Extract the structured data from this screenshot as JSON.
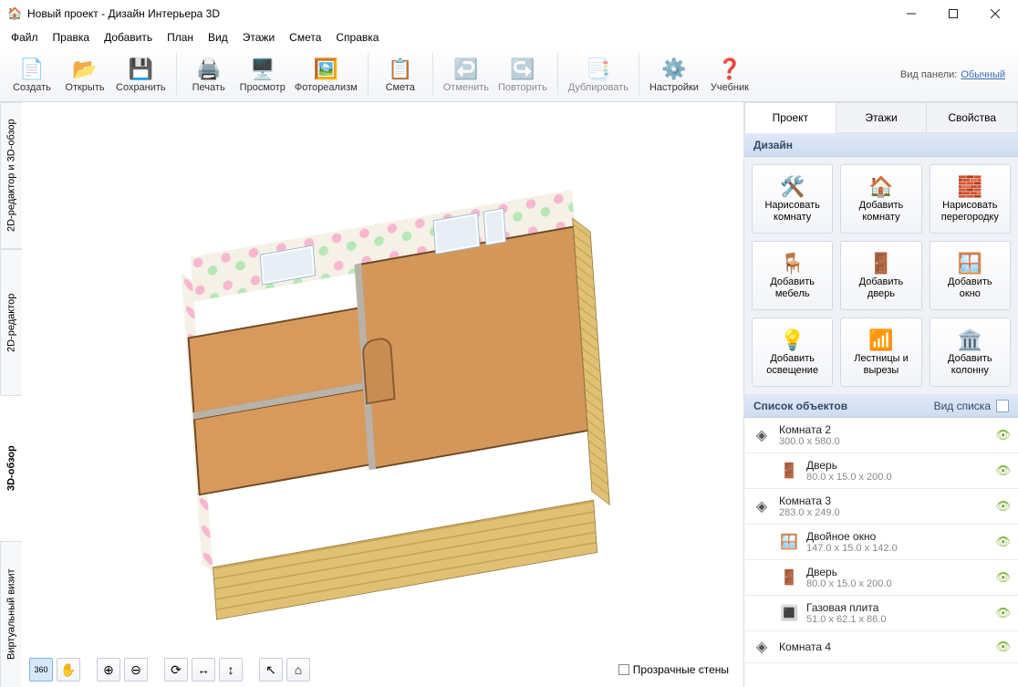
{
  "window": {
    "title": "Новый проект - Дизайн Интерьера 3D"
  },
  "menu": [
    "Файл",
    "Правка",
    "Добавить",
    "План",
    "Вид",
    "Этажи",
    "Смета",
    "Справка"
  ],
  "toolbar": {
    "groups": [
      [
        {
          "key": "create",
          "label": "Создать",
          "icon": "📄"
        },
        {
          "key": "open",
          "label": "Открыть",
          "icon": "📂"
        },
        {
          "key": "save",
          "label": "Сохранить",
          "icon": "💾"
        }
      ],
      [
        {
          "key": "print",
          "label": "Печать",
          "icon": "🖨️"
        },
        {
          "key": "preview",
          "label": "Просмотр",
          "icon": "🖥️"
        },
        {
          "key": "realism",
          "label": "Фотореализм",
          "icon": "🖼️"
        }
      ],
      [
        {
          "key": "estimate",
          "label": "Смета",
          "icon": "📋"
        }
      ],
      [
        {
          "key": "undo",
          "label": "Отменить",
          "icon": "↩️",
          "disabled": true
        },
        {
          "key": "redo",
          "label": "Повторить",
          "icon": "↪️",
          "disabled": true
        }
      ],
      [
        {
          "key": "duplicate",
          "label": "Дублировать",
          "icon": "📑",
          "disabled": true
        }
      ],
      [
        {
          "key": "settings",
          "label": "Настройки",
          "icon": "⚙️"
        },
        {
          "key": "tutorial",
          "label": "Учебник",
          "icon": "❓"
        }
      ]
    ],
    "panelLabel": "Вид панели:",
    "panelMode": "Обычный"
  },
  "leftTabs": [
    {
      "key": "2d-3d-review",
      "label": "2D-редактор и 3D-обзор"
    },
    {
      "key": "2d-editor",
      "label": "2D-редактор"
    },
    {
      "key": "3d-review",
      "label": "3D-обзор",
      "active": true
    },
    {
      "key": "virtual-visit",
      "label": "Виртуальный визит"
    }
  ],
  "viewportTools": [
    {
      "key": "orbit-360",
      "glyph": "360",
      "active": true,
      "small": true
    },
    {
      "key": "pan",
      "glyph": "✋"
    },
    {
      "key": "zoom-in",
      "glyph": "⊕"
    },
    {
      "key": "zoom-out",
      "glyph": "⊖"
    },
    {
      "key": "rotate",
      "glyph": "⟳"
    },
    {
      "key": "flip-h",
      "glyph": "↔"
    },
    {
      "key": "flip-v",
      "glyph": "↕"
    },
    {
      "key": "select",
      "glyph": "↖"
    },
    {
      "key": "home",
      "glyph": "⌂"
    }
  ],
  "transparentWalls": {
    "label": "Прозрачные стены",
    "checked": false
  },
  "rightTabs": [
    {
      "key": "project",
      "label": "Проект",
      "active": true
    },
    {
      "key": "floors",
      "label": "Этажи"
    },
    {
      "key": "properties",
      "label": "Свойства"
    }
  ],
  "designHeader": "Дизайн",
  "designButtons": [
    {
      "key": "draw-room",
      "icon": "🛠️",
      "label": "Нарисовать\nкомнату"
    },
    {
      "key": "add-room",
      "icon": "🏠",
      "label": "Добавить\nкомнату"
    },
    {
      "key": "draw-wall",
      "icon": "🧱",
      "label": "Нарисовать\nперегородку"
    },
    {
      "key": "add-furniture",
      "icon": "🪑",
      "label": "Добавить\nмебель"
    },
    {
      "key": "add-door",
      "icon": "🚪",
      "label": "Добавить\nдверь"
    },
    {
      "key": "add-window",
      "icon": "🪟",
      "label": "Добавить\nокно"
    },
    {
      "key": "add-light",
      "icon": "💡",
      "label": "Добавить\nосвещение"
    },
    {
      "key": "stairs",
      "icon": "📶",
      "label": "Лестницы и\nвырезы"
    },
    {
      "key": "add-column",
      "icon": "🏛️",
      "label": "Добавить\nколонну"
    }
  ],
  "objectsHeader": "Список объектов",
  "objectsListMode": "Вид списка",
  "objects": [
    {
      "type": "room",
      "icon": "◈",
      "name": "Комната 2",
      "dim": "300.0 x 580.0"
    },
    {
      "type": "door",
      "icon": "🚪",
      "name": "Дверь",
      "dim": "80.0 x 15.0 x 200.0",
      "child": true
    },
    {
      "type": "room",
      "icon": "◈",
      "name": "Комната 3",
      "dim": "283.0 x 249.0"
    },
    {
      "type": "window",
      "icon": "🪟",
      "name": "Двойное окно",
      "dim": "147.0 x 15.0 x 142.0",
      "child": true
    },
    {
      "type": "door",
      "icon": "🚪",
      "name": "Дверь",
      "dim": "80.0 x 15.0 x 200.0",
      "child": true
    },
    {
      "type": "stove",
      "icon": "🔳",
      "name": "Газовая плита",
      "dim": "51.0 x 62.1 x 86.0",
      "child": true
    },
    {
      "type": "room",
      "icon": "◈",
      "name": "Комната 4",
      "dim": ""
    }
  ]
}
